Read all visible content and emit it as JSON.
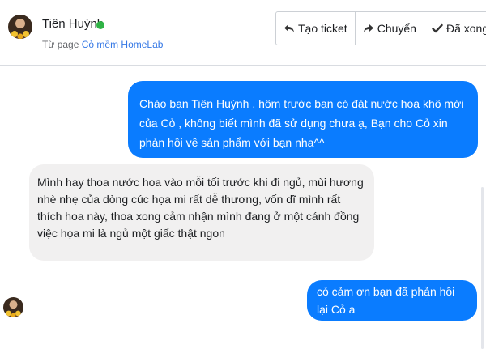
{
  "header": {
    "user_name": "Tiên Huỳnh",
    "page_prefix": "Từ page",
    "page_name": "Cỏ mềm HomeLab",
    "buttons": {
      "create_ticket": "Tạo ticket",
      "transfer": "Chuyển",
      "done": "Đã xong"
    }
  },
  "messages": [
    {
      "direction": "outgoing",
      "text": "Chào bạn Tiên Huỳnh , hôm trước bạn có đặt nước hoa khô mới của Cỏ , không biết mình đã sử dụng chưa ạ, Bạn cho Cỏ xin phản hồi về sản phẩm với bạn nha^^"
    },
    {
      "direction": "incoming",
      "text": "Mình hay thoa nước hoa vào mỗi tối trước khi đi ngủ, mùi hương nhè nhẹ của dòng cúc họa mi rất dễ thương, vốn dĩ mình rất thích hoa này, thoa xong cảm nhận mình đang ở một cánh đồng việc họa mi là ngủ một giấc thật ngon"
    },
    {
      "direction": "outgoing",
      "text": "cỏ cảm ơn bạn đã phản hồi lại Cỏ a"
    }
  ],
  "colors": {
    "outgoing_bubble": "#0a7cff",
    "incoming_bubble": "#f1f0f0",
    "online": "#2fb345",
    "page_link": "#3578e5"
  }
}
